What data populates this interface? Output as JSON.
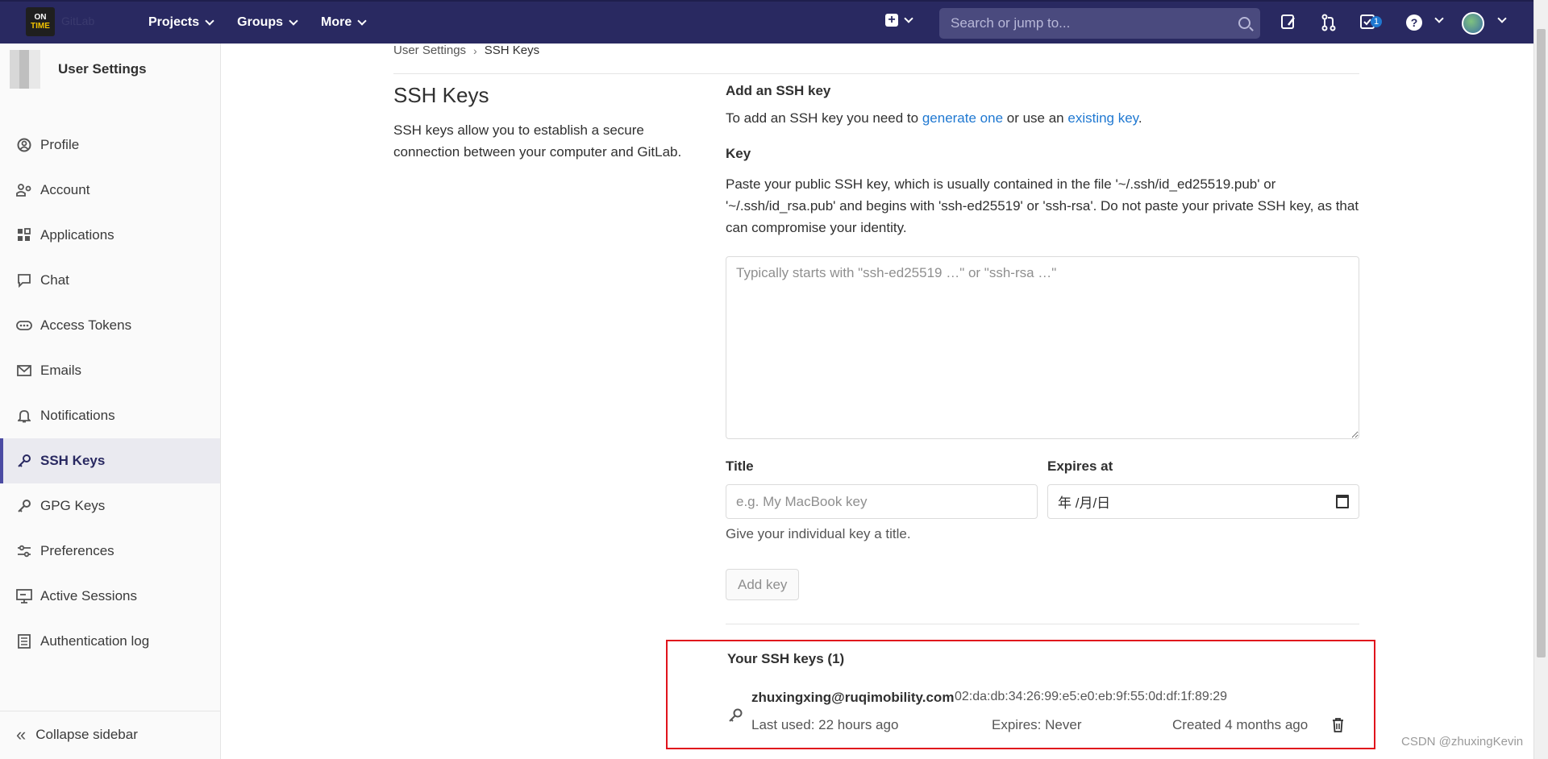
{
  "navbar": {
    "logo_line1": "ON",
    "logo_line2": "TIME",
    "logo_text": "GitLab",
    "menu": [
      {
        "label": "Projects"
      },
      {
        "label": "Groups"
      },
      {
        "label": "More"
      }
    ],
    "search_placeholder": "Search or jump to...",
    "todo_count": "1"
  },
  "sidebar": {
    "context_title": "User Settings",
    "items": [
      {
        "label": "Profile",
        "icon": "profile-icon"
      },
      {
        "label": "Account",
        "icon": "account-icon"
      },
      {
        "label": "Applications",
        "icon": "applications-icon"
      },
      {
        "label": "Chat",
        "icon": "chat-icon"
      },
      {
        "label": "Access Tokens",
        "icon": "token-icon"
      },
      {
        "label": "Emails",
        "icon": "mail-icon"
      },
      {
        "label": "Notifications",
        "icon": "bell-icon"
      },
      {
        "label": "SSH Keys",
        "icon": "key-icon",
        "active": true
      },
      {
        "label": "GPG Keys",
        "icon": "key-icon"
      },
      {
        "label": "Preferences",
        "icon": "preferences-icon"
      },
      {
        "label": "Active Sessions",
        "icon": "monitor-icon"
      },
      {
        "label": "Authentication log",
        "icon": "log-icon"
      }
    ],
    "collapse_label": "Collapse sidebar"
  },
  "breadcrumb": {
    "parent": "User Settings",
    "current": "SSH Keys"
  },
  "page": {
    "title": "SSH Keys",
    "description": "SSH keys allow you to establish a secure connection between your computer and GitLab."
  },
  "form": {
    "heading": "Add an SSH key",
    "intro_prefix": "To add an SSH key you need to ",
    "intro_link1": "generate one",
    "intro_mid": " or use an ",
    "intro_link2": "existing key",
    "intro_suffix": ".",
    "key_label": "Key",
    "key_help": "Paste your public SSH key, which is usually contained in the file '~/.ssh/id_ed25519.pub' or '~/.ssh/id_rsa.pub' and begins with 'ssh-ed25519' or 'ssh-rsa'. Do not paste your private SSH key, as that can compromise your identity.",
    "key_placeholder": "Typically starts with \"ssh-ed25519 …\" or \"ssh-rsa …\"",
    "title_label": "Title",
    "title_placeholder": "e.g. My MacBook key",
    "expires_label": "Expires at",
    "expires_value": "年 /月/日",
    "title_hint": "Give your individual key a title.",
    "add_button": "Add key"
  },
  "keys": {
    "heading": "Your SSH keys (1)",
    "list": [
      {
        "name": "zhuxingxing@ruqimobility.com",
        "fingerprint": "02:da:db:34:26:99:e5:e0:eb:9f:55:0d:df:1f:89:29",
        "last_used": "Last used: 22 hours ago",
        "expires": "Expires: Never",
        "created": "Created 4 months ago"
      }
    ]
  },
  "watermark": "CSDN @zhuxingKevin",
  "colors": {
    "navbar": "#292961",
    "link": "#1f78d1",
    "highlight_border": "#e0131c"
  }
}
